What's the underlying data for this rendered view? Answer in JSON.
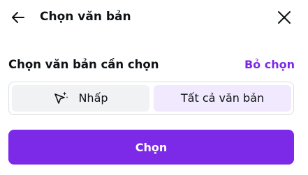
{
  "header": {
    "title": "Chọn văn bản",
    "back_icon": "arrow-left-icon",
    "close_icon": "close-icon"
  },
  "selection": {
    "label": "Chọn văn bản cần chọn",
    "deselect_label": "Bỏ chọn"
  },
  "modes": [
    {
      "label": "Nhấp",
      "icon": "magic-cursor-icon",
      "selected": false
    },
    {
      "label": "Tất cả văn bản",
      "selected": true
    }
  ],
  "action": {
    "label": "Chọn"
  },
  "colors": {
    "accent": "#7d2ae8",
    "selected_bg": "#f1e9fd",
    "unselected_bg": "#f1f2f4",
    "border": "#dcdfe4",
    "text": "#0d1216"
  }
}
